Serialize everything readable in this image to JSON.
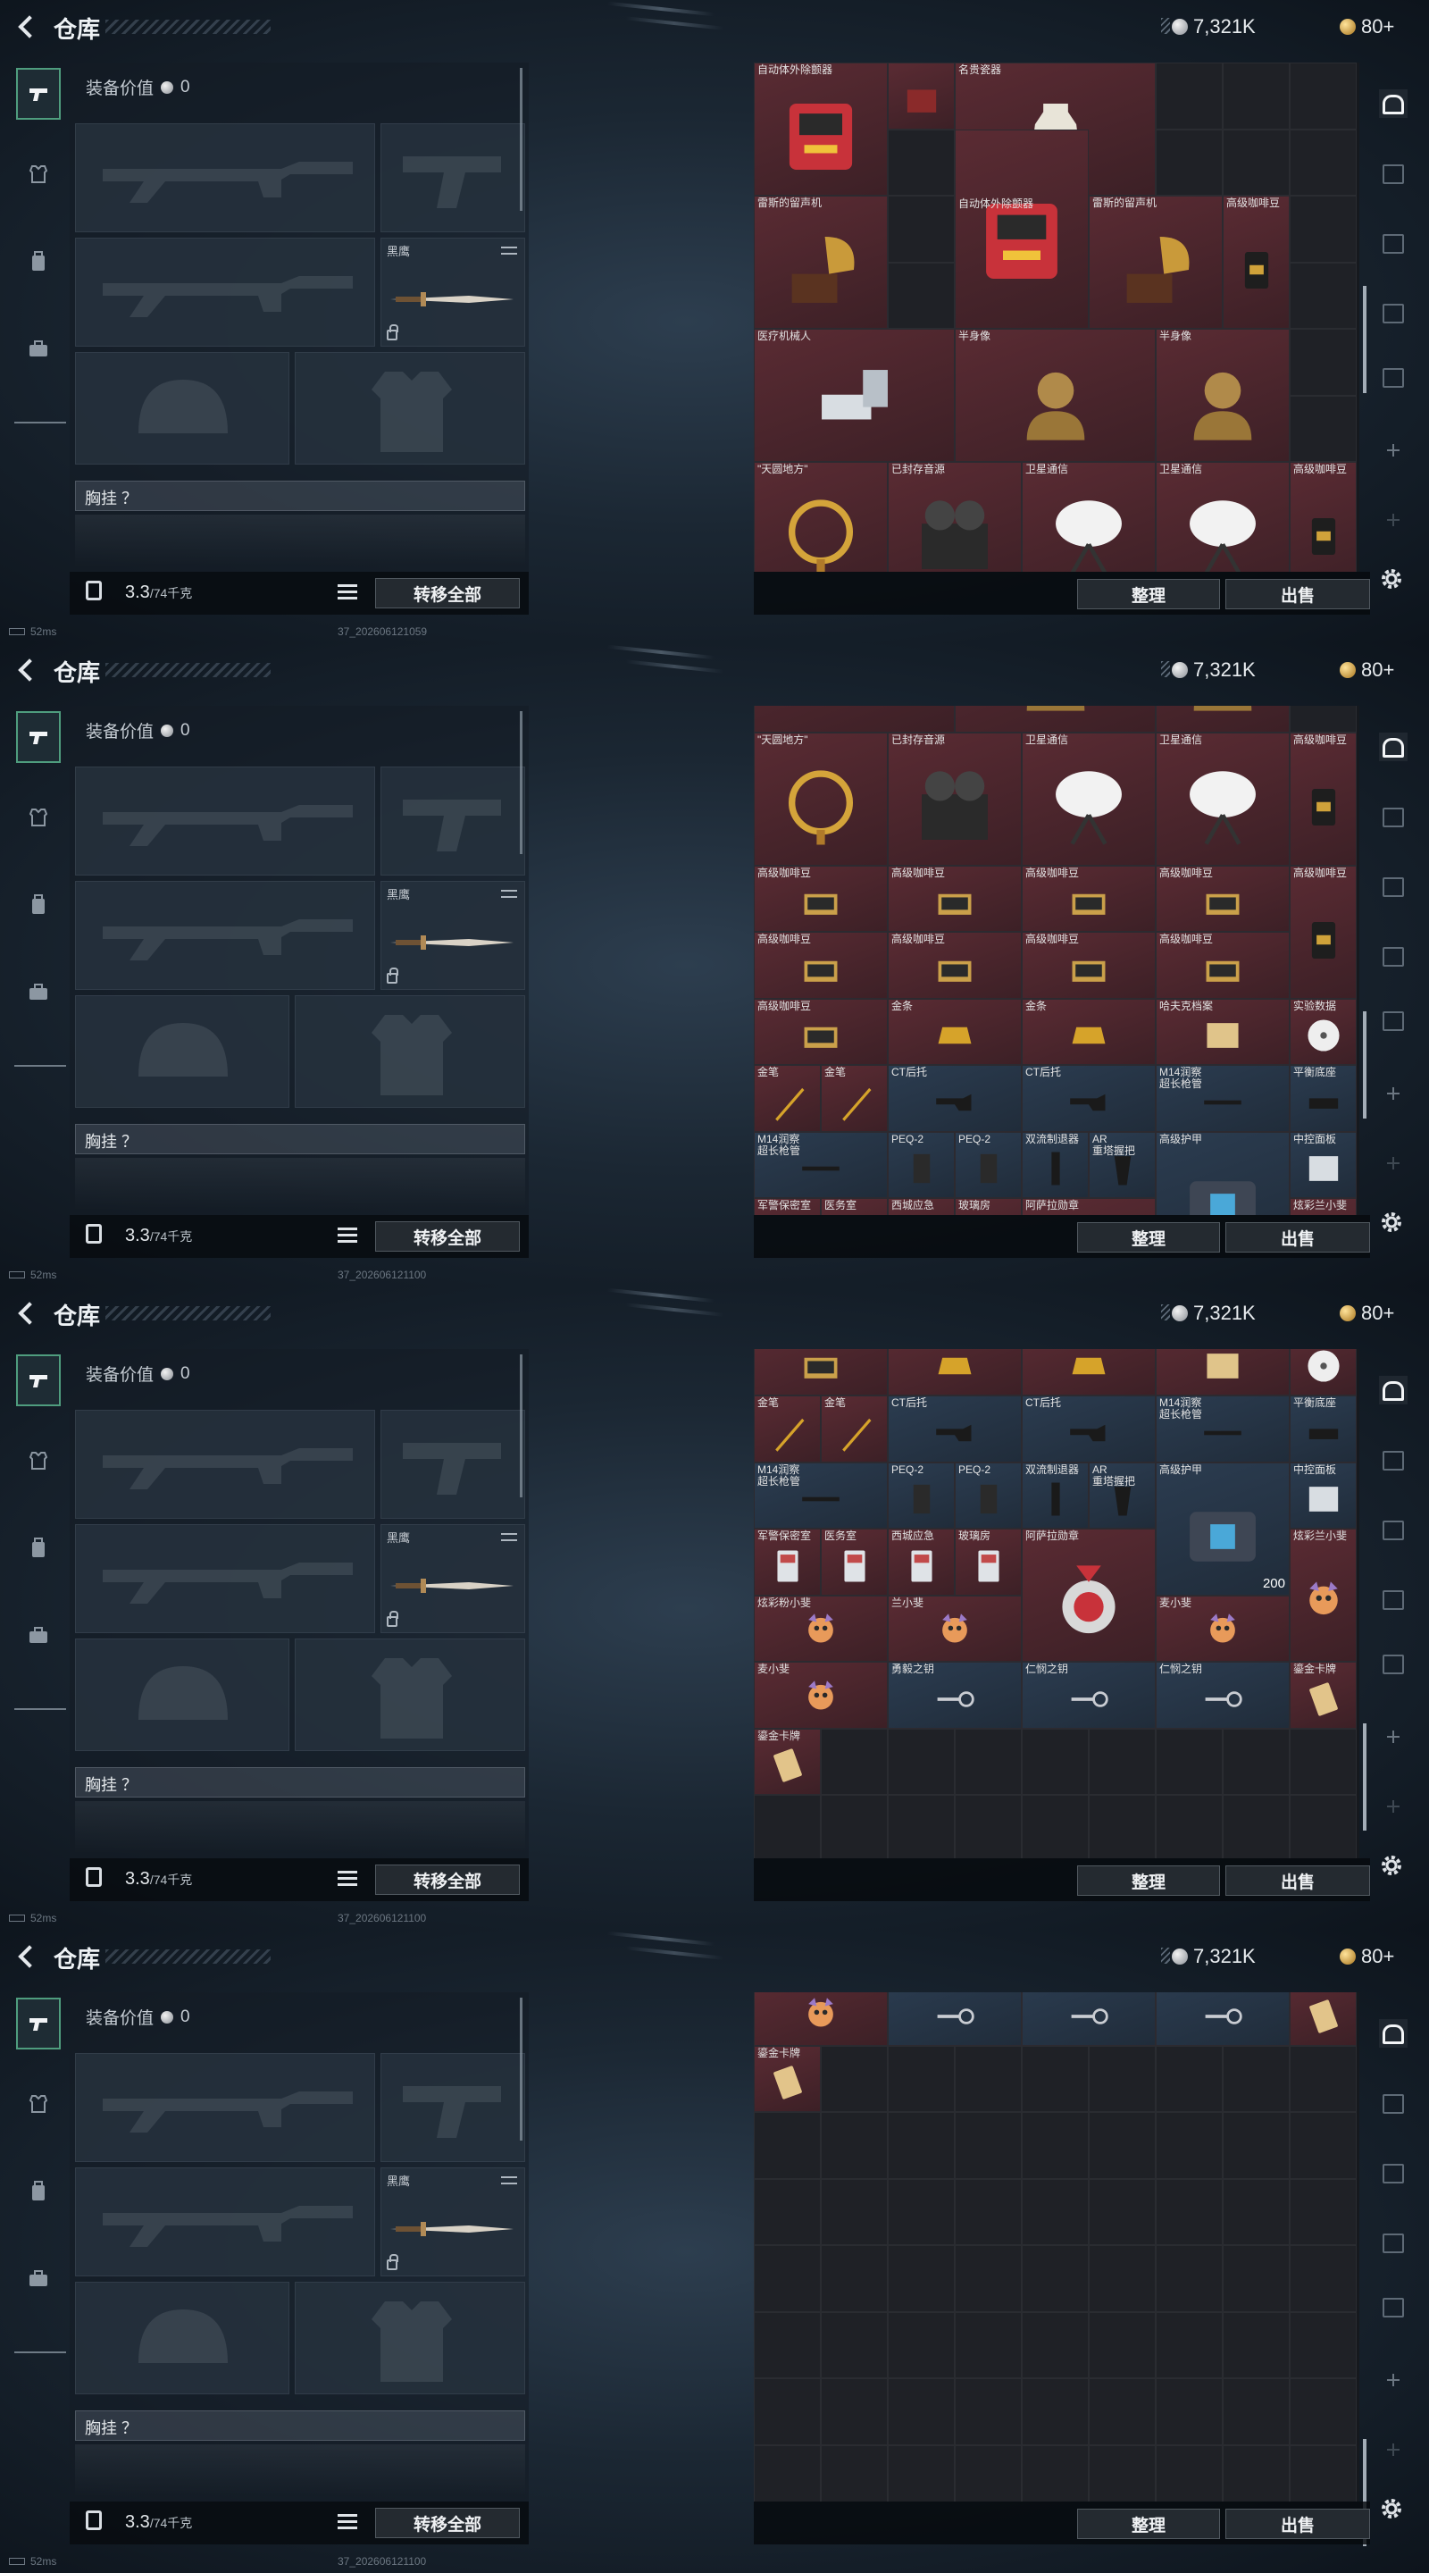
{
  "header": {
    "title": "仓库",
    "currency_silver": "7,321K",
    "currency_gold": "80+"
  },
  "loadout": {
    "value_label": "装备价值",
    "value": "0",
    "melee_label": "黑鹰",
    "chest_label": "胸挂 ？",
    "weight": "3.3",
    "weight_max": "/74千克",
    "transfer_all": "转移全部"
  },
  "buttons": {
    "sort": "整理",
    "sell": "出售"
  },
  "status": {
    "ping": "52ms",
    "versions": [
      "37_202606121059",
      "37_202606121100",
      "37_202606121100",
      "37_202606121100"
    ]
  },
  "icons": [
    "back-icon",
    "silver-coin-icon",
    "gold-coin-icon",
    "pistol-tab-icon",
    "vest-tab-icon",
    "backpack-tab-icon",
    "case-tab-icon",
    "settings-icon",
    "list-icon",
    "weight-icon"
  ],
  "colors": {
    "rare_red": "#5a2b33",
    "rare_blue": "#2b3c50",
    "empty": "#1f2126",
    "accent_green": "#4f9d7e"
  },
  "inventory": [
    {
      "name": "自动体外除颤器",
      "c": 0,
      "r": 0,
      "w": 2,
      "h": 2,
      "t": "red",
      "icon": "aed-icon"
    },
    {
      "name": "",
      "c": 2,
      "r": 0,
      "w": 1,
      "h": 1,
      "t": "red",
      "icon": "case-icon"
    },
    {
      "name": "名贵瓷器",
      "c": 3,
      "r": 0,
      "w": 3,
      "h": 2,
      "t": "red",
      "icon": "vase-icon"
    },
    {
      "name": "自动体外除颤器",
      "c": 3,
      "r": 1,
      "w": 2,
      "h": 3,
      "t": "red",
      "icon": "aed-icon",
      "label_row": 1
    },
    {
      "name": "雷斯的留声机",
      "c": 0,
      "r": 2,
      "w": 2,
      "h": 2,
      "t": "red",
      "icon": "gramophone-icon"
    },
    {
      "name": "雷斯的留声机",
      "c": 5,
      "r": 2,
      "w": 2,
      "h": 2,
      "t": "red",
      "icon": "gramophone-icon"
    },
    {
      "name": "高级咖啡豆",
      "c": 7,
      "r": 2,
      "w": 1,
      "h": 2,
      "t": "red",
      "icon": "coffee-icon"
    },
    {
      "name": "医疗机械人",
      "c": 0,
      "r": 4,
      "w": 3,
      "h": 2,
      "t": "red",
      "icon": "robot-icon"
    },
    {
      "name": "半身像",
      "c": 3,
      "r": 4,
      "w": 3,
      "h": 2,
      "t": "red",
      "icon": "bust-icon"
    },
    {
      "name": "半身像",
      "c": 6,
      "r": 4,
      "w": 2,
      "h": 2,
      "t": "red",
      "icon": "bust-icon"
    },
    {
      "name": "\"天圆地方\"",
      "c": 0,
      "r": 6,
      "w": 2,
      "h": 2,
      "t": "red",
      "icon": "armillary-icon"
    },
    {
      "name": "已封存音源",
      "c": 2,
      "r": 6,
      "w": 2,
      "h": 2,
      "t": "red",
      "icon": "reel-icon"
    },
    {
      "name": "卫星通信",
      "c": 4,
      "r": 6,
      "w": 2,
      "h": 2,
      "t": "red",
      "icon": "dish-icon"
    },
    {
      "name": "卫星通信",
      "c": 6,
      "r": 6,
      "w": 2,
      "h": 2,
      "t": "red",
      "icon": "dish-icon"
    },
    {
      "name": "高级咖啡豆",
      "c": 8,
      "r": 6,
      "w": 1,
      "h": 2,
      "t": "red",
      "icon": "coffee-icon"
    },
    {
      "name": "高级咖啡豆",
      "c": 0,
      "r": 8,
      "w": 2,
      "h": 1,
      "t": "red",
      "icon": "coffee-box-icon"
    },
    {
      "name": "高级咖啡豆",
      "c": 2,
      "r": 8,
      "w": 2,
      "h": 1,
      "t": "red",
      "icon": "coffee-box-icon"
    },
    {
      "name": "高级咖啡豆",
      "c": 4,
      "r": 8,
      "w": 2,
      "h": 1,
      "t": "red",
      "icon": "coffee-box-icon"
    },
    {
      "name": "高级咖啡豆",
      "c": 6,
      "r": 8,
      "w": 2,
      "h": 1,
      "t": "red",
      "icon": "coffee-box-icon"
    },
    {
      "name": "高级咖啡豆",
      "c": 8,
      "r": 8,
      "w": 1,
      "h": 2,
      "t": "red",
      "icon": "coffee-icon"
    },
    {
      "name": "高级咖啡豆",
      "c": 0,
      "r": 9,
      "w": 2,
      "h": 1,
      "t": "red",
      "icon": "coffee-box-icon"
    },
    {
      "name": "高级咖啡豆",
      "c": 2,
      "r": 9,
      "w": 2,
      "h": 1,
      "t": "red",
      "icon": "coffee-box-icon"
    },
    {
      "name": "高级咖啡豆",
      "c": 4,
      "r": 9,
      "w": 2,
      "h": 1,
      "t": "red",
      "icon": "coffee-box-icon"
    },
    {
      "name": "高级咖啡豆",
      "c": 6,
      "r": 9,
      "w": 2,
      "h": 1,
      "t": "red",
      "icon": "coffee-box-icon"
    },
    {
      "name": "高级咖啡豆",
      "c": 0,
      "r": 10,
      "w": 2,
      "h": 1,
      "t": "red",
      "icon": "coffee-box-icon"
    },
    {
      "name": "金条",
      "c": 2,
      "r": 10,
      "w": 2,
      "h": 1,
      "t": "red",
      "icon": "gold-bar-icon"
    },
    {
      "name": "金条",
      "c": 4,
      "r": 10,
      "w": 2,
      "h": 1,
      "t": "red",
      "icon": "gold-bar-icon"
    },
    {
      "name": "哈夫克档案",
      "c": 6,
      "r": 10,
      "w": 2,
      "h": 1,
      "t": "red",
      "icon": "archive-icon"
    },
    {
      "name": "实验数据",
      "c": 8,
      "r": 10,
      "w": 1,
      "h": 1,
      "t": "red",
      "icon": "disc-icon"
    },
    {
      "name": "金笔",
      "c": 0,
      "r": 11,
      "w": 1,
      "h": 1,
      "t": "red",
      "icon": "pen-icon"
    },
    {
      "name": "金笔",
      "c": 1,
      "r": 11,
      "w": 1,
      "h": 1,
      "t": "red",
      "icon": "pen-icon"
    },
    {
      "name": "CT后托",
      "c": 2,
      "r": 11,
      "w": 2,
      "h": 1,
      "t": "blue",
      "icon": "stock-icon"
    },
    {
      "name": "CT后托",
      "c": 4,
      "r": 11,
      "w": 2,
      "h": 1,
      "t": "blue",
      "icon": "stock-icon"
    },
    {
      "name": "M14润察",
      "sub": "超长枪管",
      "c": 6,
      "r": 11,
      "w": 2,
      "h": 1,
      "t": "blue",
      "icon": "barrel-icon"
    },
    {
      "name": "平衡底座",
      "c": 8,
      "r": 11,
      "w": 1,
      "h": 1,
      "t": "blue",
      "icon": "base-icon"
    },
    {
      "name": "M14润察",
      "sub": "超长枪管",
      "c": 0,
      "r": 12,
      "w": 2,
      "h": 1,
      "t": "blue",
      "icon": "barrel-icon"
    },
    {
      "name": "PEQ-2",
      "c": 2,
      "r": 12,
      "w": 1,
      "h": 1,
      "t": "blue",
      "icon": "laser-icon"
    },
    {
      "name": "PEQ-2",
      "c": 3,
      "r": 12,
      "w": 1,
      "h": 1,
      "t": "blue",
      "icon": "laser-icon"
    },
    {
      "name": "双流制退器",
      "c": 4,
      "r": 12,
      "w": 1,
      "h": 1,
      "t": "blue",
      "icon": "muzzle-icon"
    },
    {
      "name": "AR",
      "sub": "重塔握把",
      "c": 5,
      "r": 12,
      "w": 1,
      "h": 1,
      "t": "blue",
      "icon": "grip-icon"
    },
    {
      "name": "高级护甲",
      "c": 6,
      "r": 12,
      "w": 2,
      "h": 2,
      "t": "blue",
      "icon": "armor-icon"
    },
    {
      "name": "中控面板",
      "c": 8,
      "r": 12,
      "w": 1,
      "h": 1,
      "t": "blue",
      "icon": "panel-icon"
    },
    {
      "name": "军警保密室",
      "c": 0,
      "r": 13,
      "w": 1,
      "h": 1,
      "t": "red",
      "icon": "keycard-icon"
    },
    {
      "name": "医务室",
      "c": 1,
      "r": 13,
      "w": 1,
      "h": 1,
      "t": "red",
      "icon": "keycard-icon"
    },
    {
      "name": "西城应急",
      "c": 2,
      "r": 13,
      "w": 1,
      "h": 1,
      "t": "red",
      "icon": "keycard-icon"
    },
    {
      "name": "玻璃房",
      "c": 3,
      "r": 13,
      "w": 1,
      "h": 1,
      "t": "red",
      "icon": "keycard-icon"
    },
    {
      "name": "阿萨拉勋章",
      "c": 4,
      "r": 13,
      "w": 2,
      "h": 2,
      "t": "red",
      "icon": "medal-icon"
    },
    {
      "name": "炫彩兰小斐",
      "c": 8,
      "r": 13,
      "w": 1,
      "h": 2,
      "t": "red",
      "icon": "doll-icon"
    },
    {
      "name": "炫彩粉小斐",
      "c": 0,
      "r": 14,
      "w": 2,
      "h": 1,
      "t": "red",
      "icon": "doll-icon"
    },
    {
      "name": "兰小斐",
      "c": 2,
      "r": 14,
      "w": 2,
      "h": 1,
      "t": "red",
      "icon": "doll-icon"
    },
    {
      "name": "麦小斐",
      "c": 6,
      "r": 14,
      "w": 2,
      "h": 1,
      "t": "red",
      "icon": "doll-icon"
    },
    {
      "name": "麦小斐",
      "c": 0,
      "r": 15,
      "w": 2,
      "h": 1,
      "t": "red",
      "icon": "doll-icon"
    },
    {
      "name": "勇毅之钥",
      "c": 2,
      "r": 15,
      "w": 2,
      "h": 1,
      "t": "blue",
      "icon": "key-icon"
    },
    {
      "name": "仁悯之钥",
      "c": 4,
      "r": 15,
      "w": 2,
      "h": 1,
      "t": "blue",
      "icon": "key-icon"
    },
    {
      "name": "仁悯之钥",
      "c": 6,
      "r": 15,
      "w": 2,
      "h": 1,
      "t": "blue",
      "icon": "key-icon"
    },
    {
      "name": "鎏金卡牌",
      "c": 8,
      "r": 15,
      "w": 1,
      "h": 1,
      "t": "red",
      "icon": "card-icon"
    },
    {
      "name": "鎏金卡牌",
      "c": 0,
      "r": 16,
      "w": 1,
      "h": 1,
      "t": "red",
      "icon": "card-icon"
    }
  ],
  "badges": [
    {
      "item_index": 40,
      "text": "200"
    }
  ],
  "views": [
    {
      "scroll_rows": 0
    },
    {
      "scroll_rows": 5.6
    },
    {
      "scroll_rows": 10.3
    },
    {
      "scroll_rows": 15.2
    }
  ]
}
